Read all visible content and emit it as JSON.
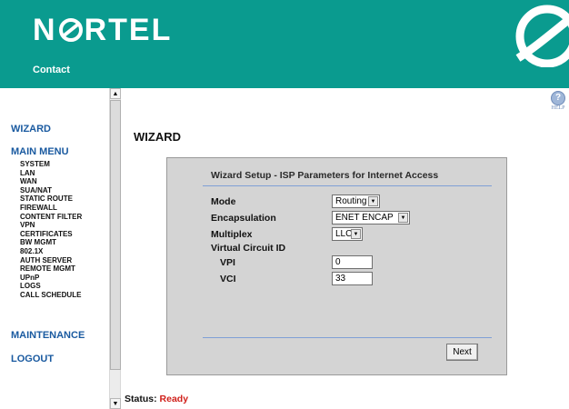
{
  "header": {
    "logo_text_left": "N",
    "logo_text_right": "RTEL",
    "contact_label": "Contact",
    "bg_color": "#0a9b8f"
  },
  "help": {
    "icon": "question-icon",
    "symbol": "?",
    "label": "HELP"
  },
  "sidebar": {
    "wizard_label": "WIZARD",
    "main_menu_label": "MAIN MENU",
    "menu_items": [
      "SYSTEM",
      "LAN",
      "WAN",
      "SUA/NAT",
      "STATIC ROUTE",
      "FIREWALL",
      "CONTENT FILTER",
      "VPN",
      "CERTIFICATES",
      "BW MGMT",
      "802.1X",
      "AUTH SERVER",
      "REMOTE MGMT",
      "UPnP",
      "LOGS",
      "CALL SCHEDULE"
    ],
    "maintenance_label": "MAINTENANCE",
    "logout_label": "LOGOUT"
  },
  "main": {
    "title": "WIZARD",
    "panel": {
      "title": "Wizard Setup - ISP Parameters for Internet Access",
      "mode_label": "Mode",
      "mode_value": "Routing",
      "encapsulation_label": "Encapsulation",
      "encapsulation_value": "ENET ENCAP",
      "multiplex_label": "Multiplex",
      "multiplex_value": "LLC",
      "vc_label": "Virtual Circuit ID",
      "vpi_label": "VPI",
      "vpi_value": "0",
      "vci_label": "VCI",
      "vci_value": "33",
      "next_label": "Next"
    }
  },
  "status": {
    "label": "Status:",
    "value": "Ready",
    "value_color": "#d0201a"
  }
}
